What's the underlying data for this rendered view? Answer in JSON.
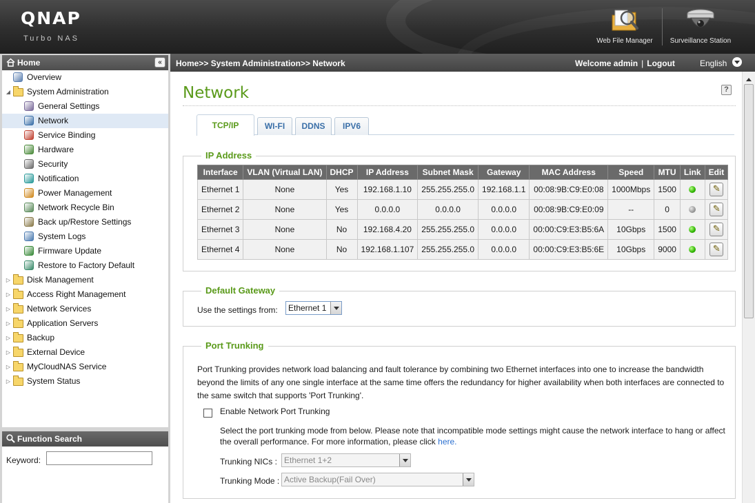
{
  "header": {
    "logo": "QNAP",
    "logo_sub": "Turbo NAS",
    "apps": [
      {
        "label": "Web File Manager",
        "icon": "folder-magnifier-icon"
      },
      {
        "label": "Surveillance Station",
        "icon": "dome-camera-icon"
      }
    ]
  },
  "sidebar": {
    "title": "Home",
    "collapse_label": "«",
    "items": [
      {
        "label": "Overview",
        "icon": "overview-icon",
        "level": 0,
        "arrow": ""
      },
      {
        "label": "System Administration",
        "icon": "folder-icon",
        "level": 0,
        "arrow": "expanded"
      },
      {
        "label": "General Settings",
        "icon": "general-settings-icon",
        "level": 1
      },
      {
        "label": "Network",
        "icon": "network-icon",
        "level": 1,
        "selected": true
      },
      {
        "label": "Service Binding",
        "icon": "service-binding-icon",
        "level": 1
      },
      {
        "label": "Hardware",
        "icon": "hardware-icon",
        "level": 1
      },
      {
        "label": "Security",
        "icon": "security-icon",
        "level": 1
      },
      {
        "label": "Notification",
        "icon": "notification-icon",
        "level": 1
      },
      {
        "label": "Power Management",
        "icon": "power-icon",
        "level": 1
      },
      {
        "label": "Network Recycle Bin",
        "icon": "recycle-bin-icon",
        "level": 1
      },
      {
        "label": "Back up/Restore Settings",
        "icon": "backup-restore-icon",
        "level": 1
      },
      {
        "label": "System Logs",
        "icon": "logs-icon",
        "level": 1
      },
      {
        "label": "Firmware Update",
        "icon": "firmware-icon",
        "level": 1
      },
      {
        "label": "Restore to Factory Default",
        "icon": "factory-default-icon",
        "level": 1
      },
      {
        "label": "Disk Management",
        "icon": "folder-icon",
        "level": 0,
        "arrow": "collapsed"
      },
      {
        "label": "Access Right Management",
        "icon": "folder-icon",
        "level": 0,
        "arrow": "collapsed"
      },
      {
        "label": "Network Services",
        "icon": "folder-icon",
        "level": 0,
        "arrow": "collapsed"
      },
      {
        "label": "Application Servers",
        "icon": "folder-icon",
        "level": 0,
        "arrow": "collapsed"
      },
      {
        "label": "Backup",
        "icon": "folder-icon",
        "level": 0,
        "arrow": "collapsed"
      },
      {
        "label": "External Device",
        "icon": "folder-icon",
        "level": 0,
        "arrow": "collapsed"
      },
      {
        "label": "MyCloudNAS Service",
        "icon": "folder-icon",
        "level": 0,
        "arrow": "collapsed"
      },
      {
        "label": "System Status",
        "icon": "folder-icon",
        "level": 0,
        "arrow": "collapsed"
      }
    ]
  },
  "function_search": {
    "title": "Function Search",
    "keyword_label": "Keyword:",
    "keyword_value": ""
  },
  "topbar": {
    "breadcrumb": "Home>> System Administration>> Network",
    "welcome": "Welcome admin",
    "separator": "|",
    "logout": "Logout",
    "language": "English"
  },
  "page": {
    "title": "Network",
    "help": "?",
    "tabs": [
      {
        "label": "TCP/IP",
        "active": true
      },
      {
        "label": "WI-FI"
      },
      {
        "label": "DDNS"
      },
      {
        "label": "IPV6"
      }
    ]
  },
  "ip_address": {
    "legend": "IP Address",
    "columns": [
      "Interface",
      "VLAN (Virtual LAN)",
      "DHCP",
      "IP Address",
      "Subnet Mask",
      "Gateway",
      "MAC Address",
      "Speed",
      "MTU",
      "Link",
      "Edit"
    ],
    "rows": [
      {
        "interface": "Ethernet 1",
        "vlan": "None",
        "dhcp": "Yes",
        "ip": "192.168.1.10",
        "mask": "255.255.255.0",
        "gateway": "192.168.1.1",
        "mac": "00:08:9B:C9:E0:08",
        "speed": "1000Mbps",
        "mtu": "1500",
        "link": "on"
      },
      {
        "interface": "Ethernet 2",
        "vlan": "None",
        "dhcp": "Yes",
        "ip": "0.0.0.0",
        "mask": "0.0.0.0",
        "gateway": "0.0.0.0",
        "mac": "00:08:9B:C9:E0:09",
        "speed": "--",
        "mtu": "0",
        "link": "off"
      },
      {
        "interface": "Ethernet 3",
        "vlan": "None",
        "dhcp": "No",
        "ip": "192.168.4.20",
        "mask": "255.255.255.0",
        "gateway": "0.0.0.0",
        "mac": "00:00:C9:E3:B5:6A",
        "speed": "10Gbps",
        "mtu": "1500",
        "link": "on"
      },
      {
        "interface": "Ethernet 4",
        "vlan": "None",
        "dhcp": "No",
        "ip": "192.168.1.107",
        "mask": "255.255.255.0",
        "gateway": "0.0.0.0",
        "mac": "00:00:C9:E3:B5:6E",
        "speed": "10Gbps",
        "mtu": "9000",
        "link": "on"
      }
    ]
  },
  "default_gateway": {
    "legend": "Default Gateway",
    "label": "Use the settings from:",
    "value": "Ethernet 1"
  },
  "port_trunking": {
    "legend": "Port Trunking",
    "description": "Port Trunking provides network load balancing and fault tolerance by combining two Ethernet interfaces into one to increase the bandwidth beyond the limits of any one single interface at the same time offers the redundancy for higher availability when both interfaces are connected to the same switch that supports 'Port Trunking'.",
    "enable_label": "Enable Network Port Trunking",
    "enabled": false,
    "note": "Select the port trunking mode from below. Please note that incompatible mode settings might cause the network interface to hang or affect the overall performance. For more information, please click",
    "note_link": "here.",
    "nics_label": "Trunking NICs :",
    "nics_value": "Ethernet 1+2",
    "mode_label": "Trunking Mode :",
    "mode_value": "Active Backup(Fail Over)"
  },
  "colors": {
    "accent_green": "#5a9a1a",
    "link_blue": "#2a6fd0",
    "header_dark": "#2e2e2e"
  }
}
